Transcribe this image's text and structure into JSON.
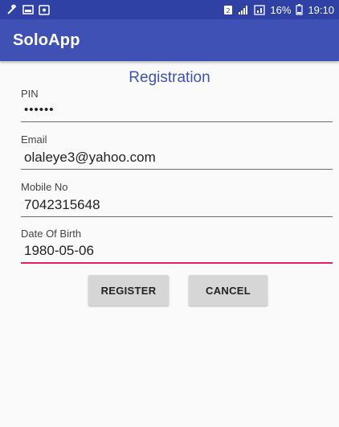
{
  "status_bar": {
    "icons_left": [
      "wrench-icon",
      "image-icon",
      "app-notification-icon"
    ],
    "icons_right": [
      "sim-icon",
      "signal-icon",
      "data-icon"
    ],
    "battery_text": "16%",
    "time": "19:10"
  },
  "app_bar": {
    "title": "SoloApp"
  },
  "form": {
    "title": "Registration",
    "fields": [
      {
        "label": "PIN",
        "value": "••••••"
      },
      {
        "label": "Email",
        "value": "olaleye3@yahoo.com"
      },
      {
        "label": "Mobile No",
        "value": "7042315648"
      },
      {
        "label": "Date Of Birth",
        "value": "1980-05-06"
      }
    ],
    "register_label": "REGISTER",
    "cancel_label": "CANCEL"
  },
  "colors": {
    "status_bar": "#3041a5",
    "app_bar": "#3f51b5",
    "accent": "#e91e63",
    "button": "#d6d6d6"
  }
}
